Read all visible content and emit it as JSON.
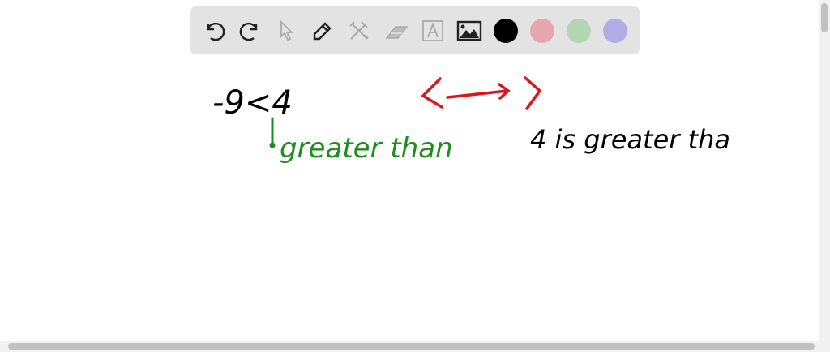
{
  "toolbar": {
    "tools": [
      "undo-icon",
      "redo-icon",
      "pointer-icon",
      "pen-icon",
      "tools-icon",
      "eraser-icon",
      "text-icon",
      "image-icon"
    ],
    "colors": {
      "black": "#000000",
      "red": "#e8a6ad",
      "green": "#b5d6b3",
      "purple": "#b3ace6"
    }
  },
  "board": {
    "expression": "-9<4",
    "green_note": "greater than",
    "black_note": "4 is greater tha",
    "ink": {
      "black": "#000000",
      "red": "#e0141e",
      "green": "#1e8c1e"
    }
  }
}
